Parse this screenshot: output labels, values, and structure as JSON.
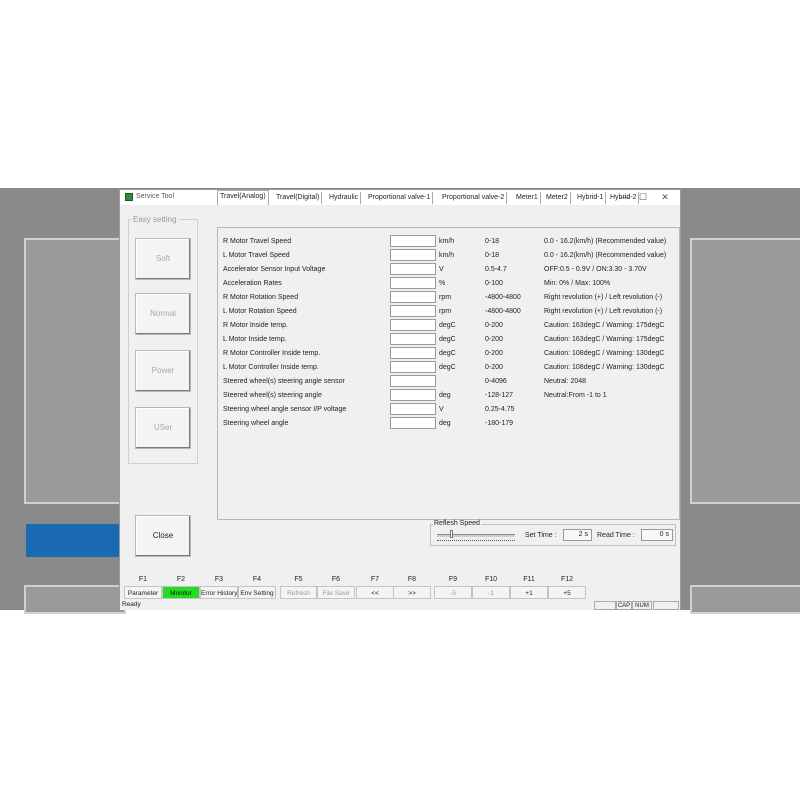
{
  "window": {
    "title": "Service Tool",
    "minimize": "—",
    "maximize": "☐",
    "close": "✕"
  },
  "easy_setting": {
    "title": "Easy setting",
    "buttons": [
      "Soft",
      "Normal",
      "Power",
      "USer"
    ]
  },
  "close_button": "Close",
  "tabs": [
    "Travel(Analog)",
    "Travel(Digital)",
    "Hydraulic",
    "Proportional valve-1",
    "Proportional valve-2",
    "Meter1",
    "Meter2",
    "Hybrid-1",
    "Hybrid-2"
  ],
  "active_tab": "Travel(Analog)",
  "rows": [
    {
      "label": "R Motor Travel Speed",
      "unit": "km/h",
      "range": "0-18",
      "note": "0.0 - 16.2(km/h) (Recommended value)"
    },
    {
      "label": "L Motor Travel Speed",
      "unit": "km/h",
      "range": "0-18",
      "note": "0.0 - 16.2(km/h) (Recommended value)"
    },
    {
      "label": "Accelerator Sensor Input Voltage",
      "unit": "V",
      "range": "0.5-4.7",
      "note": "OFF:0.5 - 0.9V / ON:3.30 - 3.70V"
    },
    {
      "label": "Acceleration Rates",
      "unit": "%",
      "range": "0-100",
      "note": "Min: 0% / Max: 100%"
    },
    {
      "label": "R Motor Rotation Speed",
      "unit": "rpm",
      "range": "-4800-4800",
      "note": "Right revolution (+) / Left revolution (-)"
    },
    {
      "label": "L Motor Rotation Speed",
      "unit": "rpm",
      "range": "-4800-4800",
      "note": "Right revolution (+) / Left revolution (-)"
    },
    {
      "label": "R Motor Inside temp.",
      "unit": "degC",
      "range": "0-200",
      "note": "Caution: 163degC / Warning: 175degC"
    },
    {
      "label": "L Motor Inside temp.",
      "unit": "degC",
      "range": "0-200",
      "note": "Caution: 163degC / Warning: 175degC"
    },
    {
      "label": "R Motor Controller Inside temp.",
      "unit": "degC",
      "range": "0-200",
      "note": "Caution: 108degC / Warning: 130degC"
    },
    {
      "label": "L Motor Controller Inside temp.",
      "unit": "degC",
      "range": "0-200",
      "note": "Caution: 108degC / Warning: 130degC"
    },
    {
      "label": "Steered wheel(s) steering angle sensor",
      "unit": "",
      "range": "0-4096",
      "note": "Neutral: 2048"
    },
    {
      "label": "Steered wheel(s) steering angle",
      "unit": "deg",
      "range": "-128-127",
      "note": "Neutral:From -1 to 1"
    },
    {
      "label": "Steering wheel angle sensor I/P voltage",
      "unit": "V",
      "range": "0.25-4.75",
      "note": ""
    },
    {
      "label": "Steering wheel angle",
      "unit": "deg",
      "range": "-180-179",
      "note": ""
    }
  ],
  "refresh": {
    "title": "Reflesh Speed",
    "set_time_label": "Set Time :",
    "set_time_value": "2 s",
    "read_time_label": "Read Time :",
    "read_time_value": "0 s"
  },
  "function_keys": [
    {
      "key": "F1",
      "label": "Parameter",
      "state": "normal"
    },
    {
      "key": "F2",
      "label": "Monitor",
      "state": "active"
    },
    {
      "key": "F3",
      "label": "Error History",
      "state": "normal"
    },
    {
      "key": "F4",
      "label": "Env Setting",
      "state": "normal"
    },
    {
      "key": "F5",
      "label": "Refresh",
      "state": "disabled"
    },
    {
      "key": "F6",
      "label": "File Save",
      "state": "disabled"
    },
    {
      "key": "F7",
      "label": "<<",
      "state": "normal"
    },
    {
      "key": "F8",
      "label": ">>",
      "state": "normal"
    },
    {
      "key": "F9",
      "label": "-5",
      "state": "disabled"
    },
    {
      "key": "F10",
      "label": "-1",
      "state": "disabled"
    },
    {
      "key": "F11",
      "label": "+1",
      "state": "normal"
    },
    {
      "key": "F12",
      "label": "+5",
      "state": "normal"
    }
  ],
  "status": {
    "text": "Ready",
    "cap": "CAP",
    "num": "NUM"
  },
  "colors": {
    "active_key": "#22dd22",
    "background_band": "#8a8a8a",
    "highlight_blue": "#1a6ab3"
  }
}
